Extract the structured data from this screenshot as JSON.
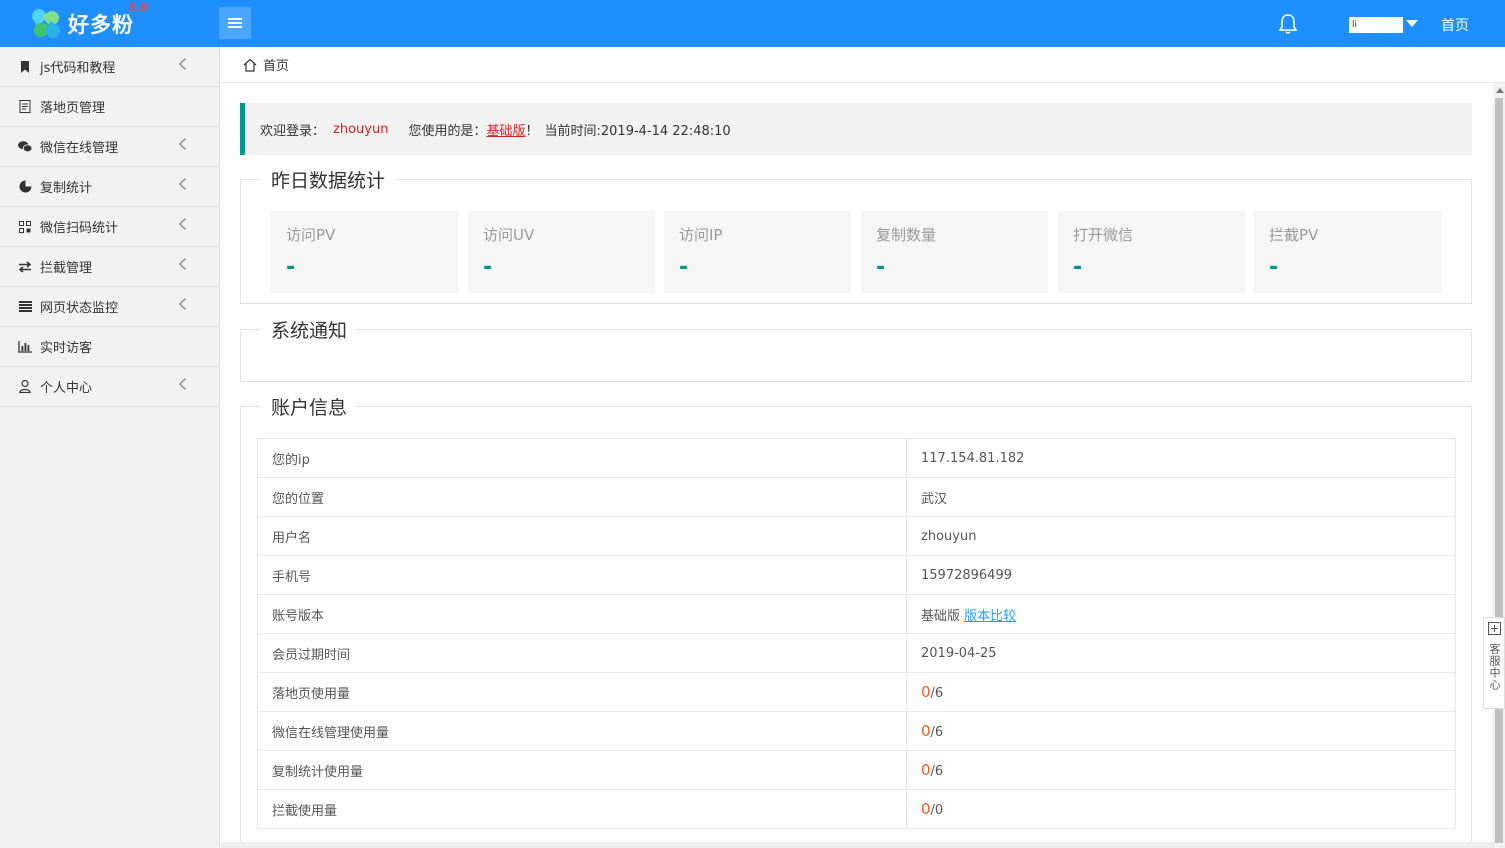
{
  "header": {
    "logo_text": "好多粉",
    "logo_version": "3.0",
    "user_name": "li",
    "home_link": "首页"
  },
  "sidebar": {
    "items": [
      {
        "label": "js代码和教程",
        "icon": "bookmark-icon",
        "has_submenu": true
      },
      {
        "label": "落地页管理",
        "icon": "page-icon",
        "has_submenu": false
      },
      {
        "label": "微信在线管理",
        "icon": "wechat-icon",
        "has_submenu": true
      },
      {
        "label": "复制统计",
        "icon": "pie-chart-icon",
        "has_submenu": true
      },
      {
        "label": "微信扫码统计",
        "icon": "qrcode-icon",
        "has_submenu": true
      },
      {
        "label": "拦截管理",
        "icon": "swap-icon",
        "has_submenu": true
      },
      {
        "label": "网页状态监控",
        "icon": "list-icon",
        "has_submenu": true
      },
      {
        "label": "实时访客",
        "icon": "bar-chart-icon",
        "has_submenu": false
      },
      {
        "label": "个人中心",
        "icon": "user-icon",
        "has_submenu": true
      }
    ]
  },
  "breadcrumb": {
    "label": "首页"
  },
  "welcome": {
    "prefix": "欢迎登录：",
    "username": "zhouyun",
    "version_prefix": "您使用的是：",
    "version": "基础版",
    "version_suffix": "！",
    "time_label": "当前时间:2019-4-14 22:48:10"
  },
  "stats": {
    "title": "昨日数据统计",
    "cards": [
      {
        "label": "访问PV",
        "value": "-"
      },
      {
        "label": "访问UV",
        "value": "-"
      },
      {
        "label": "访问IP",
        "value": "-"
      },
      {
        "label": "复制数量",
        "value": "-"
      },
      {
        "label": "打开微信",
        "value": "-"
      },
      {
        "label": "拦截PV",
        "value": "-"
      }
    ]
  },
  "notice": {
    "title": "系统通知"
  },
  "account": {
    "title": "账户信息",
    "rows": [
      {
        "key": "您的ip",
        "value": "117.154.81.182"
      },
      {
        "key": "您的位置",
        "value": "武汉"
      },
      {
        "key": "用户名",
        "value": "zhouyun"
      },
      {
        "key": "手机号",
        "value": "15972896499"
      },
      {
        "key": "账号版本",
        "value": "基础版",
        "link": "版本比较"
      },
      {
        "key": "会员过期时间",
        "value": "2019-04-25"
      },
      {
        "key": "落地页使用量",
        "used": "0",
        "total": "/6"
      },
      {
        "key": "微信在线管理使用量",
        "used": "0",
        "total": "/6"
      },
      {
        "key": "复制统计使用量",
        "used": "0",
        "total": "/6"
      },
      {
        "key": "拦截使用量",
        "used": "0",
        "total": "/0"
      }
    ]
  },
  "service": {
    "label": "客服中心"
  }
}
